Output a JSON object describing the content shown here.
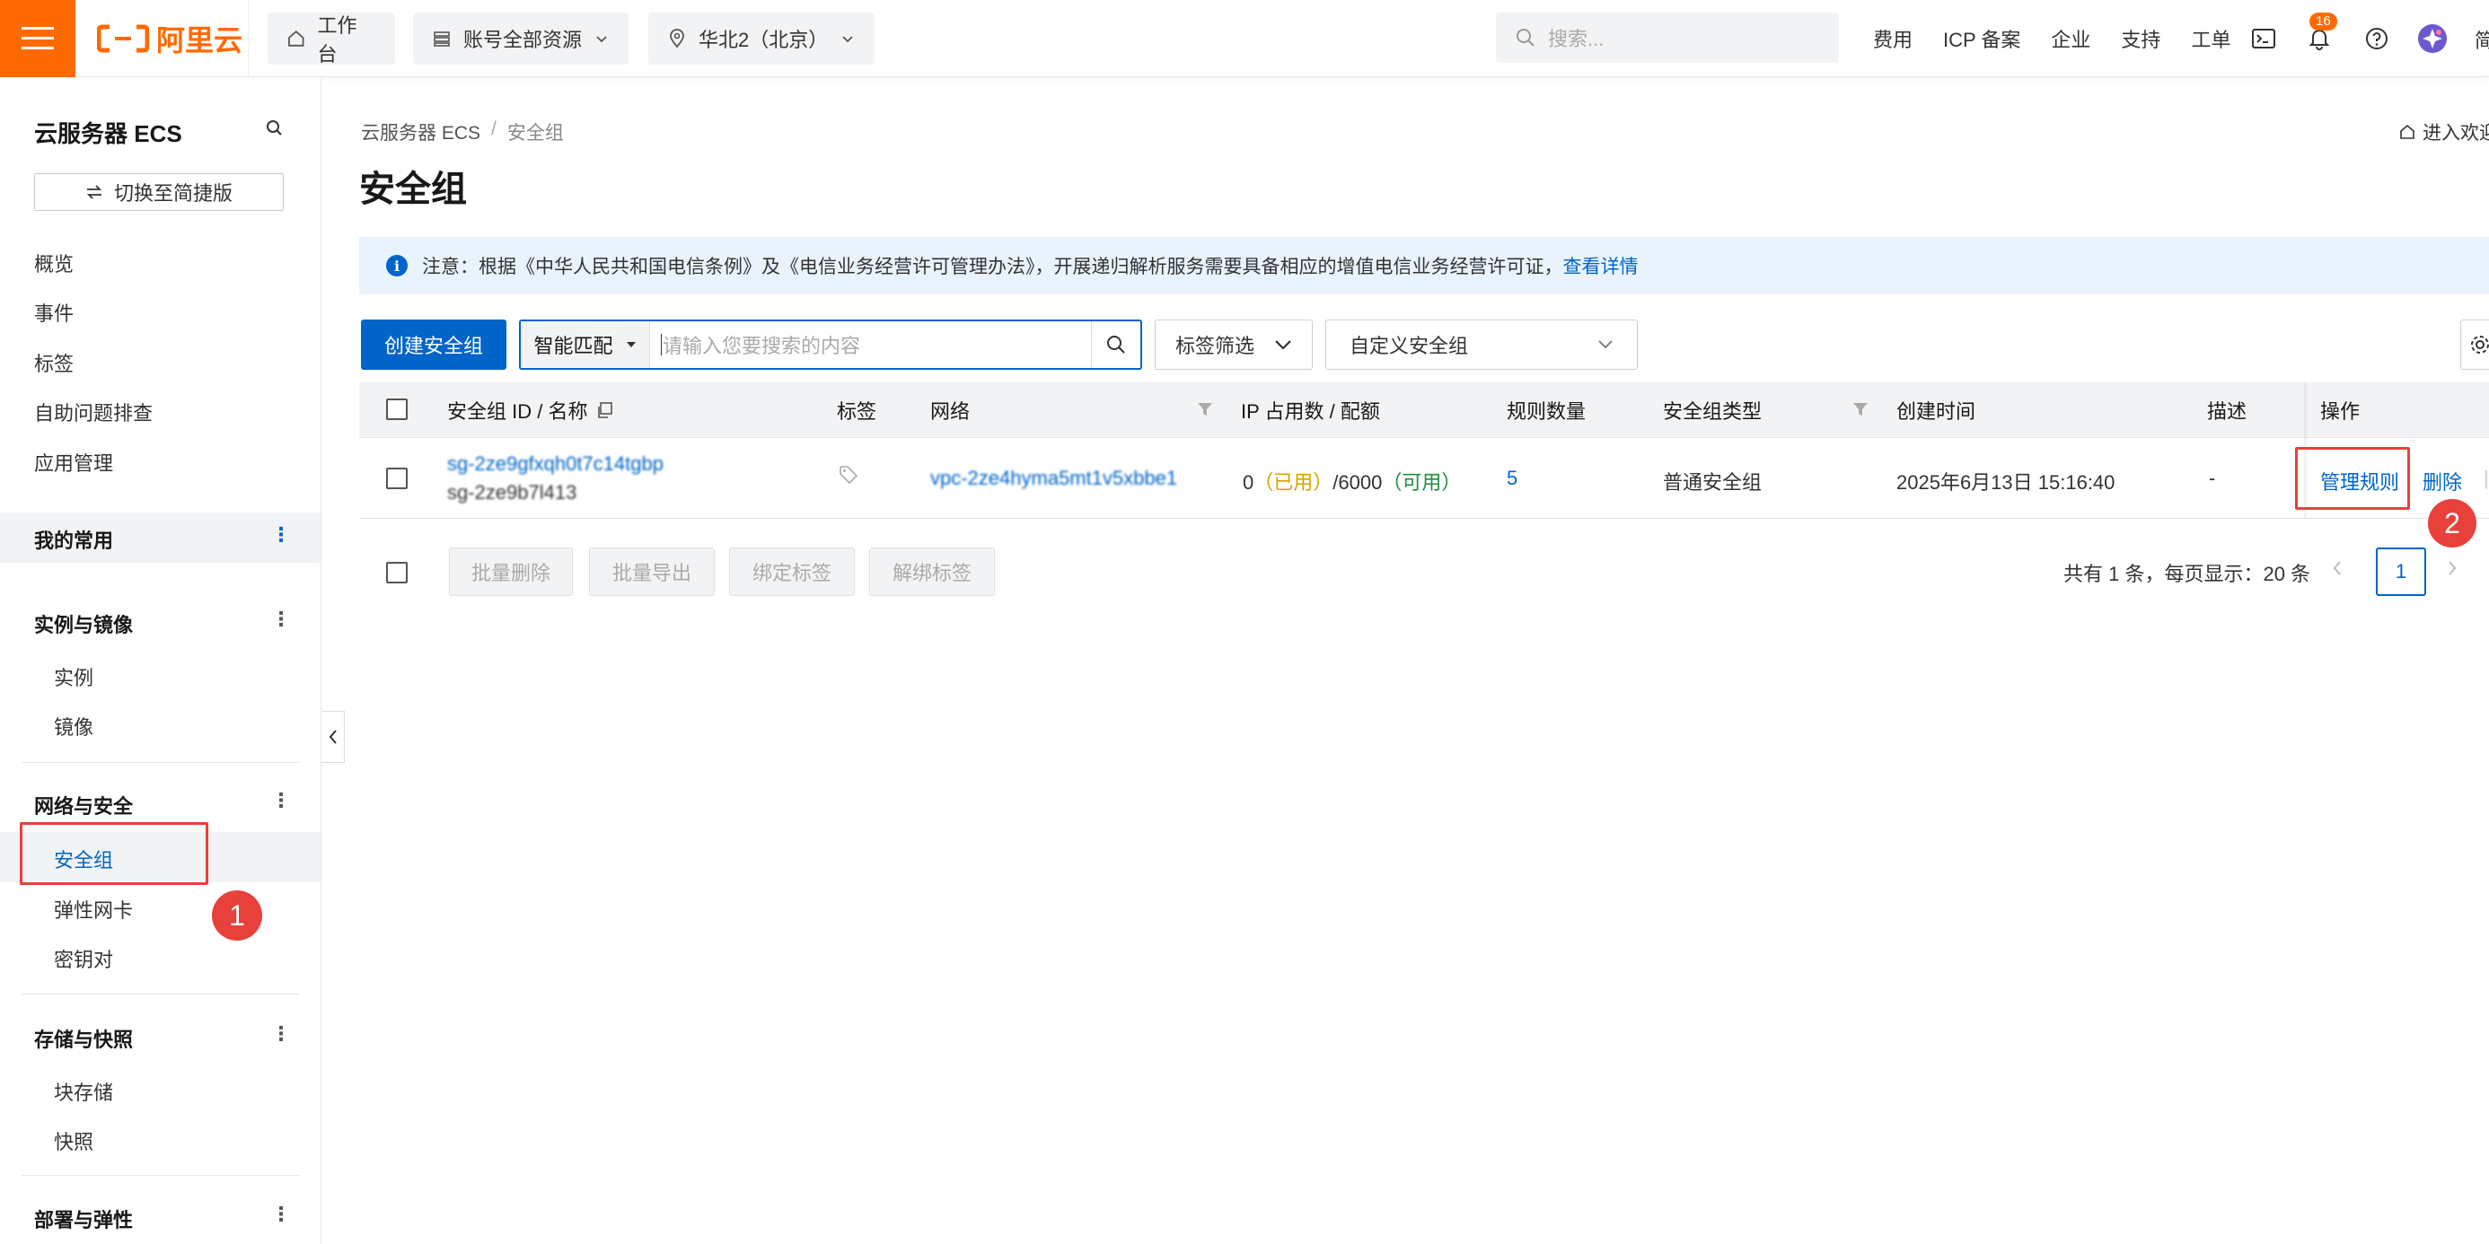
{
  "topbar": {
    "logo_text": "阿里云",
    "workbench": "工作台",
    "resources": "账号全部资源",
    "region": "华北2（北京）",
    "search_placeholder": "搜索...",
    "links": [
      "费用",
      "ICP 备案",
      "企业",
      "支持",
      "工单"
    ],
    "notification_count": "16",
    "right_partial": "简"
  },
  "sidebar": {
    "title": "云服务器 ECS",
    "switch_label": "切换至简捷版",
    "top_items": [
      "概览",
      "事件",
      "标签",
      "自助问题排查",
      "应用管理"
    ],
    "favorites": "我的常用",
    "groups": {
      "instances": {
        "label": "实例与镜像",
        "items": [
          "实例",
          "镜像"
        ]
      },
      "network": {
        "label": "网络与安全",
        "items": [
          "安全组",
          "弹性网卡",
          "密钥对"
        ]
      },
      "storage": {
        "label": "存储与快照",
        "items": [
          "块存储",
          "快照"
        ]
      },
      "deploy": {
        "label": "部署与弹性"
      }
    }
  },
  "main": {
    "breadcrumb": [
      "云服务器 ECS",
      "/",
      "安全组"
    ],
    "title": "安全组",
    "enter_link": "进入欢迎",
    "notice": {
      "text": "注意：根据《中华人民共和国电信条例》及《电信业务经营许可管理办法》，开展递归解析服务需要具备相应的增值电信业务经营许可证，",
      "link": "查看详情"
    },
    "toolbar": {
      "create": "创建安全组",
      "match_mode": "智能匹配",
      "search_placeholder": "请输入您要搜索的内容",
      "tag_filter": "标签筛选",
      "custom_select": "自定义安全组"
    },
    "table": {
      "headers": [
        "安全组 ID / 名称",
        "标签",
        "网络",
        "IP 占用数 / 配额",
        "规则数量",
        "安全组类型",
        "创建时间",
        "描述",
        "操作"
      ],
      "rows": [
        {
          "id": "sg-2ze9gfxqh0t7c14tgbp",
          "name": "sg-2ze9b7l413",
          "network": "vpc-2ze4hyma5mt1v5xbbe1",
          "ip_used": "0",
          "ip_used_label": "（已用）",
          "ip_quota": "/6000",
          "ip_avail_label": "（可用）",
          "rules": "5",
          "type": "普通安全组",
          "created": "2025年6月13日 15:16:40",
          "description": "-",
          "actions": [
            "管理规则",
            "删除"
          ]
        }
      ]
    },
    "footer": {
      "buttons": [
        "批量删除",
        "批量导出",
        "绑定标签",
        "解绑标签"
      ],
      "summary": "共有 1 条，每页显示：20 条",
      "page": "1"
    },
    "annotations": [
      "1",
      "2"
    ]
  },
  "colors": {
    "brand": "#ff6a00",
    "primary": "#0064c8",
    "annotation": "#e8403a",
    "used": "#d9a100",
    "available": "#1e8e3e"
  }
}
